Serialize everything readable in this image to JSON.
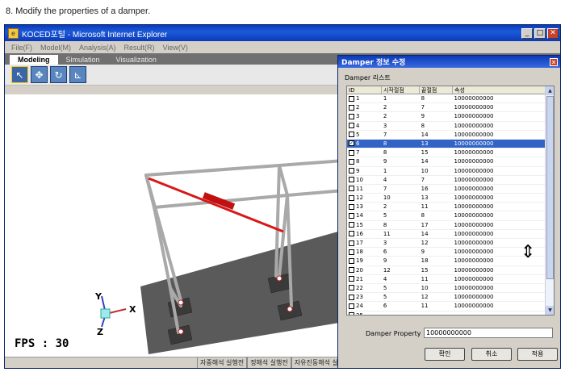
{
  "caption": "8. Modify the properties of a damper.",
  "window": {
    "title": "KOCED포털 - Microsoft Internet Explorer",
    "minimize": "_",
    "maximize": "□",
    "close": "✕"
  },
  "menu": [
    "File(F)",
    "Model(M)",
    "Analysis(A)",
    "Result(R)",
    "View(V)"
  ],
  "tabs": [
    "Modeling",
    "Simulation",
    "Visualization"
  ],
  "tools": [
    {
      "icon": "arrow-pointer-icon",
      "glyph": "↖"
    },
    {
      "icon": "move-icon",
      "glyph": "✥"
    },
    {
      "icon": "rotate-icon",
      "glyph": "↻"
    },
    {
      "icon": "axes-icon",
      "glyph": "⊾"
    }
  ],
  "viewport": {
    "fps": "FPS : 30",
    "axis_x": "X",
    "axis_y": "Y",
    "axis_z": "Z"
  },
  "status": [
    "자중해석 실행전",
    "정해석 실행전",
    "자유진동해석 실"
  ],
  "dialog": {
    "title": "Damper 정보 수정",
    "close": "✕",
    "list_label": "Damper 리스트",
    "columns": [
      "ID",
      "시작절점",
      "끝절점",
      "속성"
    ],
    "rows": [
      {
        "id": "1",
        "start": "1",
        "end": "8",
        "prop": "10000000000",
        "checked": false
      },
      {
        "id": "2",
        "start": "2",
        "end": "7",
        "prop": "10000000000",
        "checked": false
      },
      {
        "id": "3",
        "start": "2",
        "end": "9",
        "prop": "10000000000",
        "checked": false
      },
      {
        "id": "4",
        "start": "3",
        "end": "8",
        "prop": "10000000000",
        "checked": false
      },
      {
        "id": "5",
        "start": "7",
        "end": "14",
        "prop": "10000000000",
        "checked": false
      },
      {
        "id": "6",
        "start": "8",
        "end": "13",
        "prop": "10000000000",
        "checked": true
      },
      {
        "id": "7",
        "start": "8",
        "end": "15",
        "prop": "10000000000",
        "checked": false
      },
      {
        "id": "8",
        "start": "9",
        "end": "14",
        "prop": "10000000000",
        "checked": false
      },
      {
        "id": "9",
        "start": "1",
        "end": "10",
        "prop": "10000000000",
        "checked": false
      },
      {
        "id": "10",
        "start": "4",
        "end": "7",
        "prop": "10000000000",
        "checked": false
      },
      {
        "id": "11",
        "start": "7",
        "end": "16",
        "prop": "10000000000",
        "checked": false
      },
      {
        "id": "12",
        "start": "10",
        "end": "13",
        "prop": "10000000000",
        "checked": false
      },
      {
        "id": "13",
        "start": "2",
        "end": "11",
        "prop": "10000000000",
        "checked": false
      },
      {
        "id": "14",
        "start": "5",
        "end": "8",
        "prop": "10000000000",
        "checked": false
      },
      {
        "id": "15",
        "start": "8",
        "end": "17",
        "prop": "10000000000",
        "checked": false
      },
      {
        "id": "16",
        "start": "11",
        "end": "14",
        "prop": "10000000000",
        "checked": false
      },
      {
        "id": "17",
        "start": "3",
        "end": "12",
        "prop": "10000000000",
        "checked": false
      },
      {
        "id": "18",
        "start": "6",
        "end": "9",
        "prop": "10000000000",
        "checked": false
      },
      {
        "id": "19",
        "start": "9",
        "end": "18",
        "prop": "10000000000",
        "checked": false
      },
      {
        "id": "20",
        "start": "12",
        "end": "15",
        "prop": "10000000000",
        "checked": false
      },
      {
        "id": "21",
        "start": "4",
        "end": "11",
        "prop": "10000000000",
        "checked": false
      },
      {
        "id": "22",
        "start": "5",
        "end": "10",
        "prop": "10000000000",
        "checked": false
      },
      {
        "id": "23",
        "start": "5",
        "end": "12",
        "prop": "10000000000",
        "checked": false
      },
      {
        "id": "24",
        "start": "6",
        "end": "11",
        "prop": "10000000000",
        "checked": false
      },
      {
        "id": "25",
        "start": "",
        "end": "",
        "prop": "",
        "checked": false
      }
    ],
    "selected_row": 5,
    "property_label": "Damper Property",
    "property_value": "10000000000",
    "buttons": [
      "확인",
      "취소",
      "적용"
    ]
  },
  "colors": {
    "title_blue": "#0a3ab8",
    "selection": "#3164c6",
    "damper_red": "#d81818",
    "frame_gray": "#a9a9a9",
    "slab_gray": "#5a5a5a"
  }
}
